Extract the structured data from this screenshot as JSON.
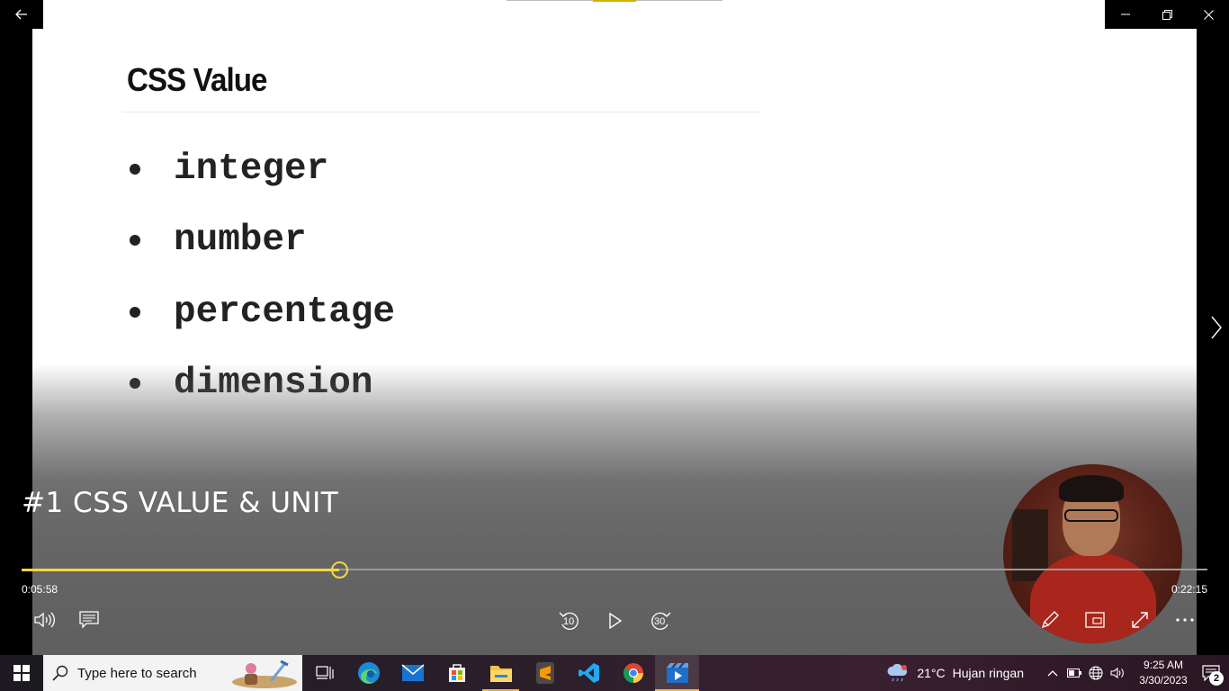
{
  "window": {
    "back_icon": "back-arrow-icon",
    "controls": [
      "minimize-icon",
      "restore-icon",
      "close-icon"
    ]
  },
  "slide": {
    "title": "CSS Value",
    "bullets": [
      "integer",
      "number",
      "percentage",
      "dimension"
    ]
  },
  "player": {
    "video_title": "#1 CSS VALUE & UNIT",
    "time_elapsed": "0:05:58",
    "time_total": "0:22:15",
    "progress_fraction": 0.2682,
    "accent_color": "#f6d740",
    "skip_back_label": "10",
    "skip_forward_label": "30",
    "icons": [
      "volume-icon",
      "subtitles-icon",
      "skip-back-icon",
      "play-icon",
      "skip-forward-icon",
      "pen-icon",
      "miniview-icon",
      "fullscreen-icon",
      "more-icon",
      "next-arrow-icon"
    ]
  },
  "taskbar": {
    "search_placeholder": "Type here to search",
    "apps": [
      "task-view-icon",
      "edge-icon",
      "mail-icon",
      "store-icon",
      "file-explorer-icon",
      "sublime-text-icon",
      "vscode-icon",
      "chrome-icon",
      "movies-tv-icon"
    ],
    "weather_temp": "21°C",
    "weather_desc": "Hujan ringan",
    "time": "9:25 AM",
    "date": "3/30/2023",
    "notification_count": "2"
  }
}
